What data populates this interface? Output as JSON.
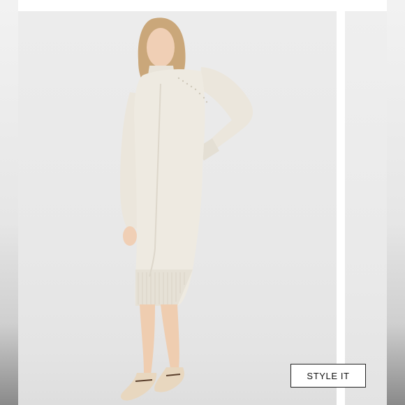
{
  "product_gallery": {
    "style_it_button_label": "STYLE IT"
  },
  "colors": {
    "background": "#ffffff",
    "slide_background": "#ececec",
    "dress": "#eeeae1",
    "button_border": "#222222"
  }
}
